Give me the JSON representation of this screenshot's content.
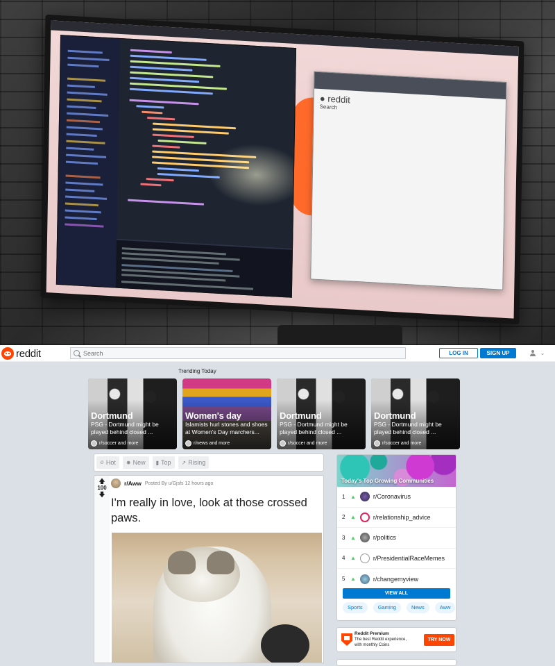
{
  "header": {
    "logo_text": "reddit",
    "search_placeholder": "Search",
    "login_label": "LOG IN",
    "signup_label": "SIGN UP",
    "user_menu_caret": "⌄"
  },
  "trending": {
    "title": "Trending Today",
    "cards": [
      {
        "title": "Dortmund",
        "desc": "PSG - Dortmund might be played behind closed ...",
        "sub": "r/soccer and more"
      },
      {
        "title": "Women's day",
        "desc": "Islamists hurl stones and shoes at Women's Day marchers...",
        "sub": "r/news and more"
      },
      {
        "title": "Dortmund",
        "desc": "PSG - Dortmund might be played behind closed ...",
        "sub": "r/soccer and more"
      },
      {
        "title": "Dortmund",
        "desc": "PSG - Dortmund might be played behind closed ...",
        "sub": "r/soccer and more"
      }
    ]
  },
  "sort": {
    "hot": "Hot",
    "new": "New",
    "top": "Top",
    "rising": "Rising"
  },
  "post": {
    "votes": "100",
    "subreddit": "r/Aww",
    "meta": "Posted By u/Gjsfs 12 hours ago",
    "title": "I'm really in love, look at those crossed paws."
  },
  "communities": {
    "title": "Today's Top Growing Communities",
    "items": [
      {
        "rank": "1",
        "name": "r/Coronavirus"
      },
      {
        "rank": "2",
        "name": "r/relationship_advice"
      },
      {
        "rank": "3",
        "name": "r/politics"
      },
      {
        "rank": "4",
        "name": "r/PresidentialRaceMemes"
      },
      {
        "rank": "5",
        "name": "r/changemyview"
      }
    ],
    "view_all": "VIEW ALL",
    "tags": [
      "Sports",
      "Gaming",
      "News",
      "Aww"
    ]
  },
  "premium": {
    "title": "Reddit Premium",
    "desc": "The best Reddit experience, with monthly Coins",
    "cta": "TRY NOW"
  },
  "colors": {
    "brand_orange": "#ff4500",
    "link_blue": "#0079d3",
    "page_bg": "#dae0e6"
  }
}
